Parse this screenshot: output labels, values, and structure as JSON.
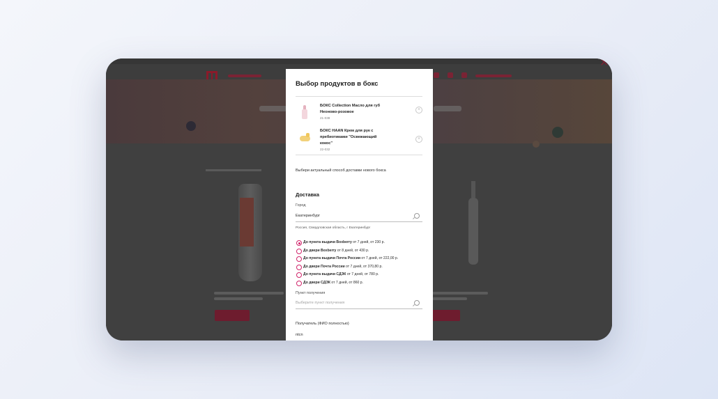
{
  "modal": {
    "title": "Выбор продуктов в бокс",
    "items": [
      {
        "name": "БОКС Collection Масло для губ Неоново-розовое",
        "code": "21-038"
      },
      {
        "name": "БОКС HAAN Крем для рук с пребиотиками \"Освежающий кокос\"",
        "code": "22-032"
      }
    ],
    "delivery_note": "Выбери актуальный способ доставки нового бокса",
    "delivery_heading": "Доставка",
    "city_label": "Город",
    "city_value": "Екатеринбург",
    "city_hint": "Россия, Свердловская область, г Екатеринбург",
    "options": [
      {
        "bold": "До пункта выдачи Boxberry",
        "rest": " от 7 дней, от 230 р.",
        "selected": true
      },
      {
        "bold": "До двери Boxberry",
        "rest": " от 8 дней, от 430 р.",
        "selected": false
      },
      {
        "bold": "До пункта выдачи Почта России",
        "rest": " от 7 дней, от 222,00 р.",
        "selected": false
      },
      {
        "bold": "До двери Почта России",
        "rest": " от 7 дней, от 370,80 р.",
        "selected": false
      },
      {
        "bold": "До пункта выдачи СДЭК",
        "rest": " от 7 дней, от 780 р.",
        "selected": false
      },
      {
        "bold": "До двери СДЭК",
        "rest": " от 7 дней, от 860 р.",
        "selected": false
      }
    ],
    "pickup_label": "Пункт получения",
    "pickup_placeholder": "Выберите пункт получения",
    "recipient_label": "Получатель (ФИО полностью)",
    "recipient_value": "ntcn"
  },
  "colors": {
    "accent": "#d1256b",
    "overlay": "#404040"
  },
  "icons": [
    "close-icon",
    "search-icon",
    "remove-icon"
  ]
}
